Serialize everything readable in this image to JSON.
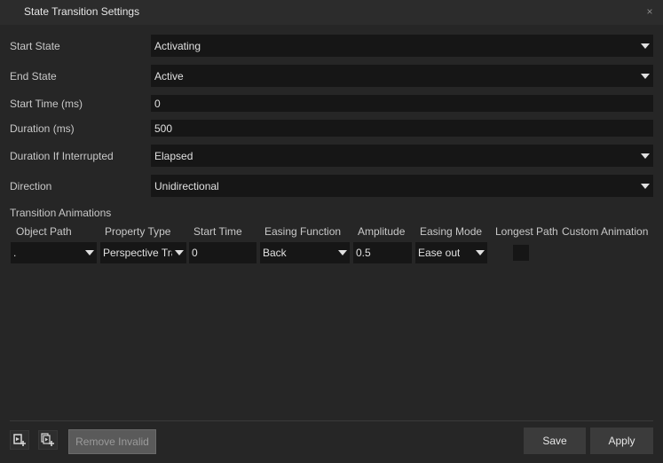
{
  "window": {
    "title": "State Transition Settings",
    "close_glyph": "×"
  },
  "form": {
    "start_state": {
      "label": "Start State",
      "value": "Activating"
    },
    "end_state": {
      "label": "End State",
      "value": "Active"
    },
    "start_time": {
      "label": "Start Time (ms)",
      "value": "0"
    },
    "duration": {
      "label": "Duration (ms)",
      "value": "500"
    },
    "duration_if_interrupted": {
      "label": "Duration If Interrupted",
      "value": "Elapsed"
    },
    "direction": {
      "label": "Direction",
      "value": "Unidirectional"
    }
  },
  "animations": {
    "section_label": "Transition Animations",
    "columns": [
      "Object Path",
      "Property Type",
      "Start Time",
      "Easing Function",
      "Amplitude",
      "Easing Mode",
      "Longest Path",
      "Custom Animation"
    ],
    "rows": [
      {
        "object_path": ".",
        "property_type": "Perspective Tra",
        "start_time": "0",
        "easing_function": "Back",
        "amplitude": "0.5",
        "easing_mode": "Ease out",
        "longest_path": false
      }
    ]
  },
  "footer": {
    "add_animation_icon": "add-animation-icon",
    "add_custom_animation_icon": "add-custom-animation-icon",
    "remove_invalid_label": "Remove Invalid",
    "save_label": "Save",
    "apply_label": "Apply"
  }
}
